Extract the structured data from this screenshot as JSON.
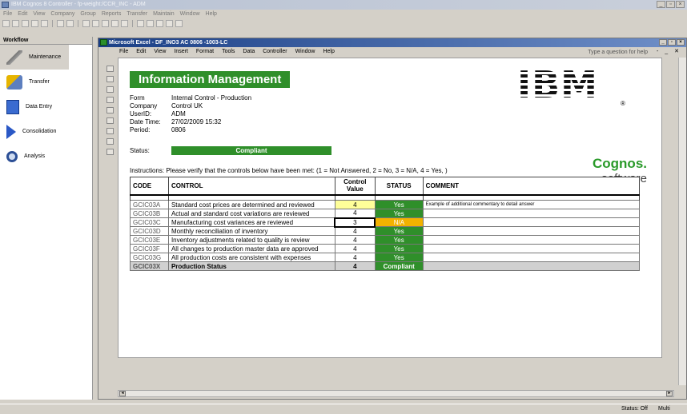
{
  "app": {
    "title": "IBM Cognos 8 Controller - fp-weight:/CCR_INC - ADM",
    "menu": [
      "File",
      "Edit",
      "View",
      "Company",
      "Group",
      "Reports",
      "Transfer",
      "Maintain",
      "Window",
      "Help"
    ]
  },
  "workflow": {
    "header": "Workflow",
    "items": [
      {
        "label": "Maintenance",
        "icon": "wrench-icon"
      },
      {
        "label": "Transfer",
        "icon": "transfer-icon"
      },
      {
        "label": "Data Entry",
        "icon": "data-entry-icon"
      },
      {
        "label": "Consolidation",
        "icon": "consolidation-icon"
      },
      {
        "label": "Analysis",
        "icon": "analysis-icon"
      }
    ]
  },
  "excel": {
    "title": "Microsoft Excel - DF_INO3 AC 0806 -1003-LC",
    "menu": [
      "File",
      "Edit",
      "View",
      "Insert",
      "Format",
      "Tools",
      "Data",
      "Controller",
      "Window",
      "Help"
    ],
    "question_placeholder": "Type a question for help",
    "window_controls": "- _ ✕"
  },
  "sheet": {
    "banner": "Information Management",
    "info": [
      {
        "label": "Form",
        "value": "Internal Control - Production"
      },
      {
        "label": "Company",
        "value": "Control UK"
      },
      {
        "label": "UserID:",
        "value": "ADM"
      },
      {
        "label": "Date Time:",
        "value": "27/02/2009 15:32"
      },
      {
        "label": "Period:",
        "value": "0806"
      }
    ],
    "status_label": "Status:",
    "status_value": "Compliant",
    "instructions": "Instructions: Please verify that the controls below have been met:  (1 = Not Answered, 2 = No, 3 = N/A, 4 = Yes, )",
    "logo_ibm": "IBM",
    "logo_reg": "®",
    "logo_cognos": "Cognos.",
    "logo_software": "software"
  },
  "table": {
    "headers": [
      "CODE",
      "CONTROL",
      "Control Value",
      "STATUS",
      "COMMENT"
    ],
    "rows": [
      {
        "code": "GCIC03A",
        "control": "Standard cost prices are determined and reviewed",
        "value": "4",
        "status": "Yes",
        "comment": "Example of additional commentary to detail answer"
      },
      {
        "code": "GCIC03B",
        "control": "Actual and standard cost variations are reviewed",
        "value": "4",
        "status": "Yes",
        "comment": ""
      },
      {
        "code": "GCIC03C",
        "control": "Manufacturing cost variances are reviewed",
        "value": "3",
        "status": "N/A",
        "comment": ""
      },
      {
        "code": "GCIC03D",
        "control": "Monthly reconciliation of inventory",
        "value": "4",
        "status": "Yes",
        "comment": ""
      },
      {
        "code": "GCIC03E",
        "control": "Inventory adjustments related to quality is review",
        "value": "4",
        "status": "Yes",
        "comment": ""
      },
      {
        "code": "GCIC03F",
        "control": "All changes to production master data are approved",
        "value": "4",
        "status": "Yes",
        "comment": ""
      },
      {
        "code": "GCIC03G",
        "control": "All production costs are consistent with expenses",
        "value": "4",
        "status": "Yes",
        "comment": ""
      }
    ],
    "total": {
      "code": "GCIC03X",
      "control": "Production Status",
      "value": "4",
      "status": "Compliant",
      "comment": ""
    }
  },
  "statusbar": {
    "status": "Status: Off",
    "mode": "Multi"
  },
  "colors": {
    "green": "#2f8f2a",
    "amber": "#f2b200",
    "yellow_input": "#ffff99"
  }
}
